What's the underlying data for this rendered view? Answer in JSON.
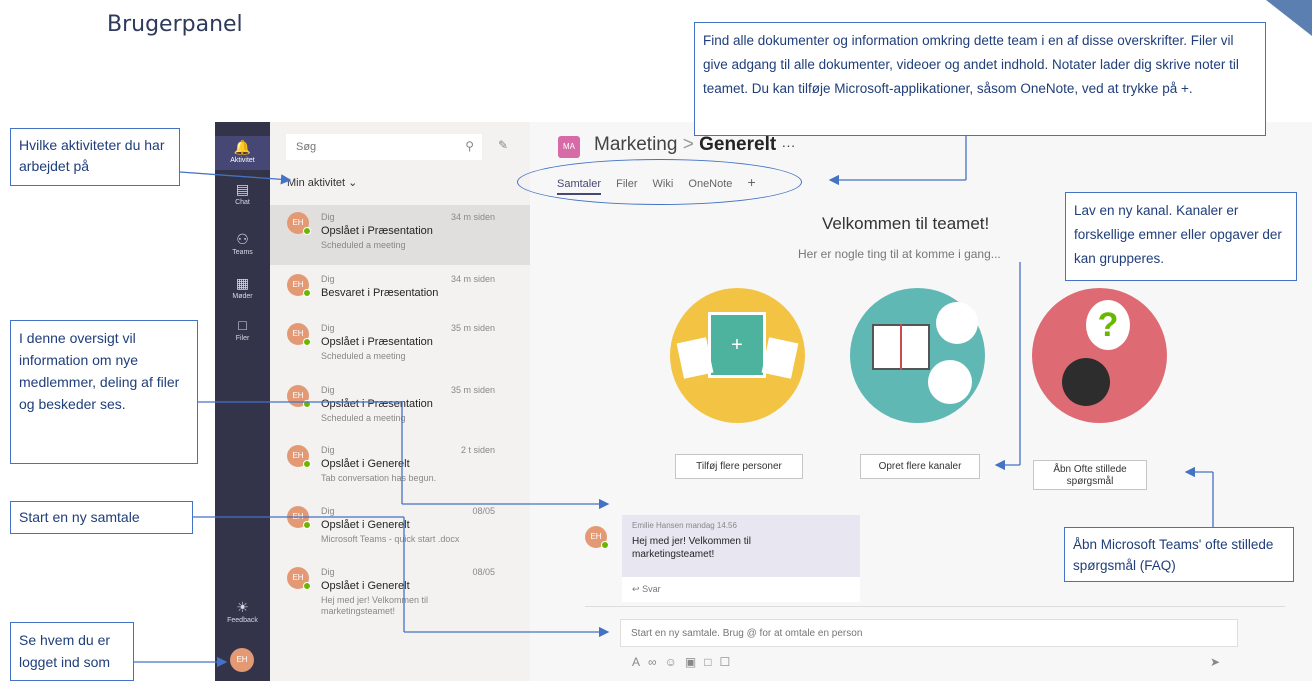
{
  "slide": {
    "title": "Brugerpanel"
  },
  "appbar": {
    "items": [
      {
        "label": "Aktivitet",
        "icon": "bell-icon"
      },
      {
        "label": "Chat",
        "icon": "chat-icon"
      },
      {
        "label": "Teams",
        "icon": "teams-icon"
      },
      {
        "label": "Møder",
        "icon": "calendar-icon"
      },
      {
        "label": "Filer",
        "icon": "file-icon"
      },
      {
        "label": "Feedback",
        "icon": "lightbulb-icon"
      }
    ],
    "me_initials": "EH"
  },
  "feed": {
    "search_placeholder": "Søg",
    "filter_label": "Min aktivitet",
    "items": [
      {
        "initials": "EH",
        "who": "Dig",
        "time": "34 m siden",
        "main": "Opslået i Præsentation",
        "sub": "Scheduled a meeting"
      },
      {
        "initials": "EH",
        "who": "Dig",
        "time": "34 m siden",
        "main": "Besvaret i Præsentation",
        "sub": ""
      },
      {
        "initials": "EH",
        "who": "Dig",
        "time": "35 m siden",
        "main": "Opslået i Præsentation",
        "sub": "Scheduled a meeting"
      },
      {
        "initials": "EH",
        "who": "Dig",
        "time": "35 m siden",
        "main": "Opslået i Præsentation",
        "sub": "Scheduled a meeting"
      },
      {
        "initials": "EH",
        "who": "Dig",
        "time": "2 t siden",
        "main": "Opslået i Generelt",
        "sub": "Tab conversation has begun."
      },
      {
        "initials": "EH",
        "who": "Dig",
        "time": "08/05",
        "main": "Opslået i Generelt",
        "sub": "Microsoft Teams - quick start .docx"
      },
      {
        "initials": "EH",
        "who": "Dig",
        "time": "08/05",
        "main": "Opslået i Generelt",
        "sub": "Hej med jer! Velkommen til marketingsteamet!"
      }
    ]
  },
  "main": {
    "team_initials": "MA",
    "team": "Marketing",
    "separator": ">",
    "channel": "Generelt",
    "more": "···",
    "tabs": [
      "Samtaler",
      "Filer",
      "Wiki",
      "OneNote",
      "+"
    ],
    "welcome_title": "Velkommen til teamet!",
    "welcome_sub": "Her er nogle ting til at komme i gang...",
    "buttons": {
      "add_people": "Tilføj flere personer",
      "create_channels": "Opret flere kanaler",
      "faq_line1": "Åbn Ofte stillede",
      "faq_line2": "spørgsmål"
    },
    "message": {
      "initials": "EH",
      "meta": "Emilie Hansen   mandag 14.56",
      "text": "Hej med jer! Velkommen til marketingsteamet!",
      "reply": "Svar"
    },
    "composer_placeholder": "Start en ny samtale. Brug @ for at omtale en person"
  },
  "callouts": {
    "activities": "Hvilke aktiviteter du har arbejdet på",
    "tabs_info": "Find alle dokumenter og information omkring dette team i en af disse overskrifter. Filer vil give adgang til alle dokumenter, videoer og andet indhold. Notater lader dig skrive noter til teamet. Du kan tilføje Microsoft-applikationer, såsom OneNote, ved at trykke på +.",
    "overview": "I denne oversigt vil information om nye medlemmer, deling af filer og beskeder ses.",
    "new_conversation": "Start en ny samtale",
    "logged_in": "Se hvem du er logget ind som",
    "new_channel": "Lav en ny kanal. Kanaler er forskellige emner eller opgaver der kan grupperes.",
    "faq": "Åbn Microsoft Teams' ofte stillede spørgsmål (FAQ)"
  }
}
